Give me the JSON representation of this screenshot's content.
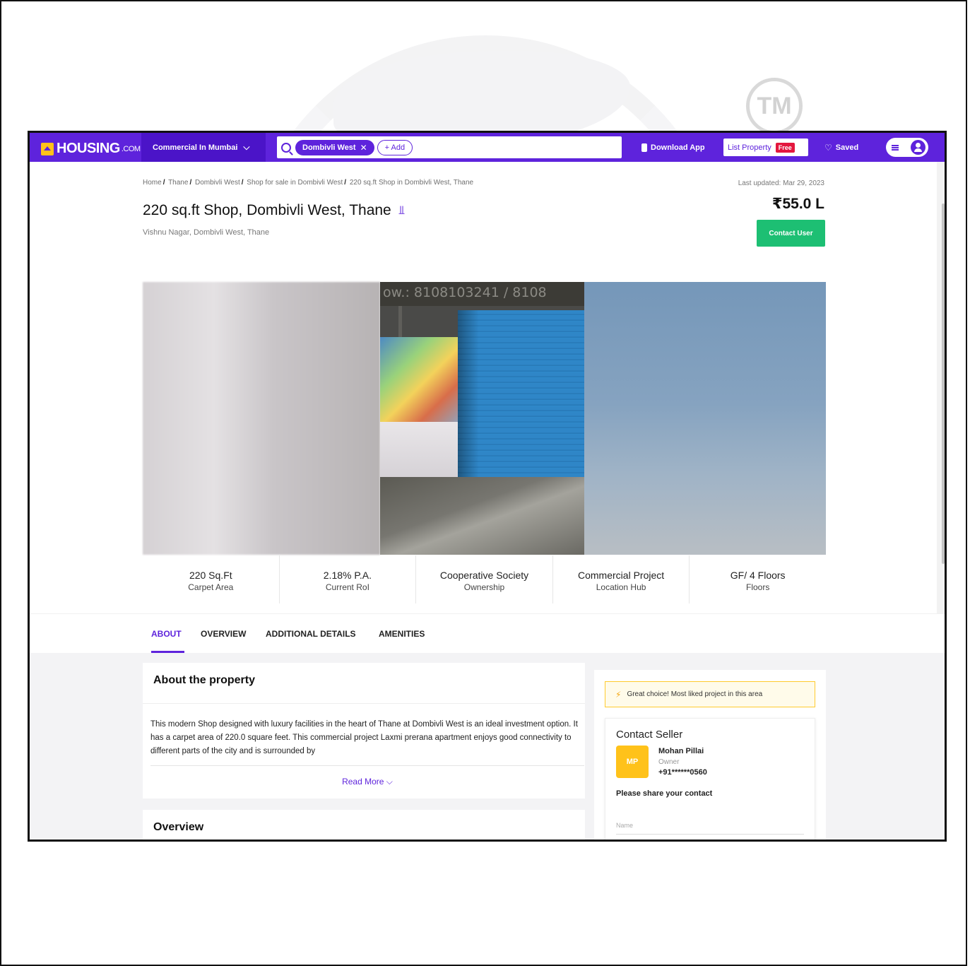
{
  "watermark": {
    "tm": "TM"
  },
  "nav": {
    "logo_main": "HOUSING",
    "logo_suffix": ".COM",
    "city_select": "Commercial In Mumbai",
    "search": {
      "chip": "Dombivli West",
      "add": "+ Add"
    },
    "download": "Download App",
    "list_property": "List Property",
    "free_badge": "Free",
    "saved": "Saved",
    "accent": "#5e23dc"
  },
  "breadcrumb": [
    "Home",
    "Thane",
    "Dombivli West",
    "Shop for sale in Dombivli West",
    "220 sq.ft Shop in Dombivli West, Thane"
  ],
  "header": {
    "last_updated": "Last updated: Mar 29, 2023",
    "title": "220 sq.ft Shop, Dombivli West, Thane",
    "subtitle": "Vishnu Nagar, Dombivli West, Thane",
    "price": "₹55.0 L",
    "contact_button": "Contact User",
    "contact_color": "#1dbf73"
  },
  "gallery": {
    "sign_text": "ow.: 8108103241 / 8108"
  },
  "stats": [
    {
      "value": "220 Sq.Ft",
      "label": "Carpet Area"
    },
    {
      "value": "2.18% P.A.",
      "label": "Current RoI"
    },
    {
      "value": "Cooperative Society",
      "label": "Ownership"
    },
    {
      "value": "Commercial Project",
      "label": "Location Hub"
    },
    {
      "value": "GF/ 4 Floors",
      "label": "Floors"
    }
  ],
  "tabs": [
    "ABOUT",
    "OVERVIEW",
    "ADDITIONAL DETAILS",
    "AMENITIES"
  ],
  "about": {
    "heading": "About the property",
    "text": "This modern Shop designed with luxury facilities in the heart of Thane at Dombivli West is an ideal investment option. It has a carpet area of 220.0 square feet. This commercial project Laxmi prerana apartment enjoys good connectivity to different parts of the city and is surrounded by",
    "read_more": "Read More"
  },
  "overview": {
    "heading": "Overview"
  },
  "side": {
    "great_choice": "Great choice! Most liked project in this area",
    "contact_title": "Contact Seller",
    "seller_initials": "MP",
    "seller_name": "Mohan Pillai",
    "seller_role": "Owner",
    "seller_phone": "+91******0560",
    "share_contact": "Please share your contact",
    "name_placeholder": "Name"
  }
}
